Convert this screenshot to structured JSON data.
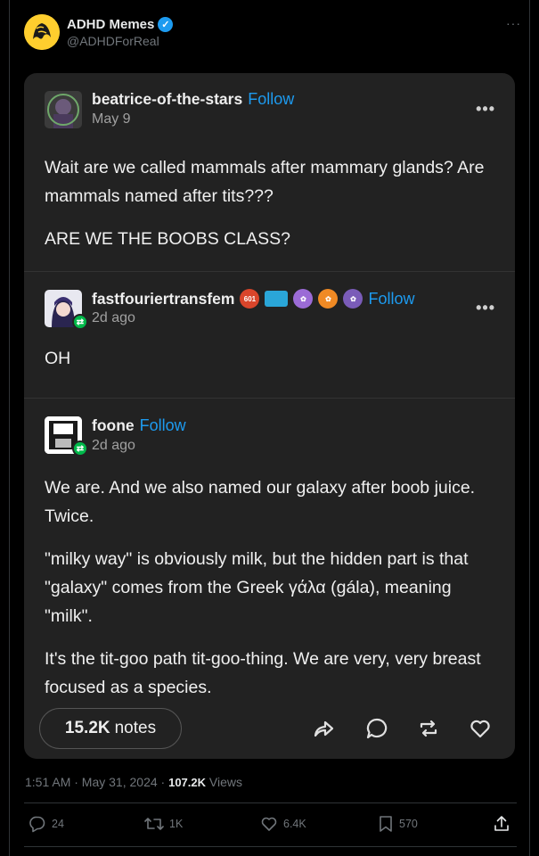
{
  "tweet": {
    "author_name": "ADHD Memes",
    "author_handle": "@ADHDForReal",
    "more": "···",
    "timestamp": "1:51 AM · May 31, 2024 · ",
    "views_count": "107.2K",
    "views_label": " Views",
    "stats": {
      "replies": "24",
      "reposts": "1K",
      "likes": "6.4K",
      "bookmarks": "570"
    }
  },
  "tumblr": {
    "follow_label": "Follow",
    "more": "•••",
    "posts": [
      {
        "username": "beatrice-of-the-stars",
        "date": "May 9",
        "paragraphs": [
          "Wait are we called mammals after mammary glands? Are mammals named after tits???",
          "ARE WE THE BOOBS CLASS?"
        ]
      },
      {
        "username": "fastfouriertransfem",
        "date": "2d ago",
        "paragraphs": [
          "OH"
        ]
      },
      {
        "username": "foone",
        "date": "2d ago",
        "paragraphs": [
          "We are. And we also named our galaxy after boob juice. Twice.",
          "\"milky way\" is obviously milk, but the hidden part is that \"galaxy\" comes from the Greek γάλα (gála), meaning \"milk\".",
          "It's the tit-goo path tit-goo-thing. We are very, very breast focused as a species."
        ]
      }
    ],
    "notes_count": "15.2K",
    "notes_label": "notes",
    "badge_text": "601"
  },
  "colors": {
    "accent": "#1d9bf0",
    "card": "#222222",
    "reblog": "#00b84a"
  }
}
